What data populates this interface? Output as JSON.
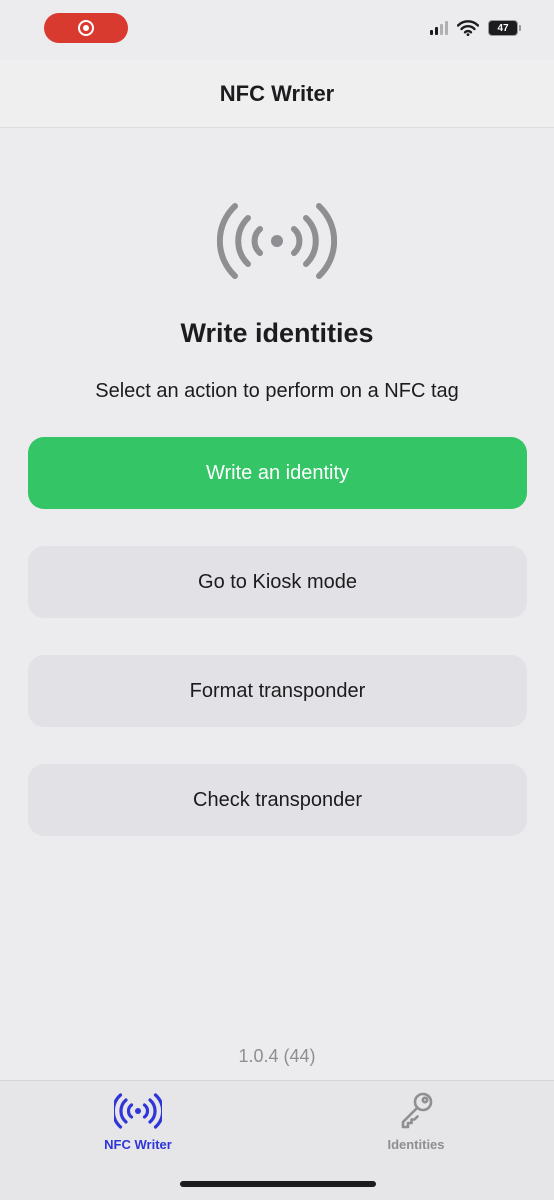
{
  "status_bar": {
    "recording_icon": "screen-recording-icon",
    "battery_level": "47",
    "signal_icon": "cellular-signal-icon",
    "wifi_icon": "wifi-icon"
  },
  "nav": {
    "title": "NFC Writer"
  },
  "main": {
    "hero_icon": "nfc-waves-icon",
    "heading": "Write identities",
    "subtitle": "Select an action to perform on a NFC tag",
    "actions": [
      {
        "label": "Write an identity",
        "style": "primary"
      },
      {
        "label": "Go to Kiosk mode",
        "style": "secondary"
      },
      {
        "label": "Format transponder",
        "style": "secondary"
      },
      {
        "label": "Check transponder",
        "style": "secondary"
      }
    ],
    "version": "1.0.4 (44)"
  },
  "tab_bar": {
    "tabs": [
      {
        "label": "NFC Writer",
        "icon": "nfc-waves-icon",
        "selected": true
      },
      {
        "label": "Identities",
        "icon": "key-icon",
        "selected": false
      }
    ]
  },
  "colors": {
    "primary_button": "#34c566",
    "secondary_button": "#e2e2e6",
    "tab_selected": "#2f35d8",
    "tab_unselected": "#8e8e93",
    "recording_pill": "#d93a30",
    "background": "#ececee"
  }
}
